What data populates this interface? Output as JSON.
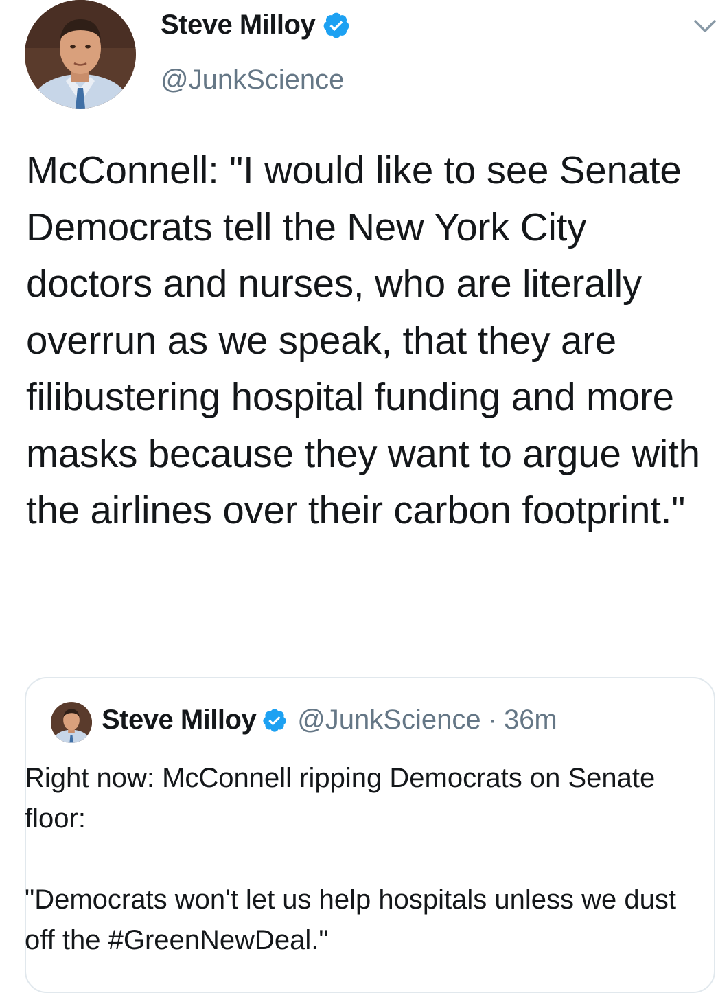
{
  "author": {
    "name": "Steve Milloy",
    "handle": "@JunkScience",
    "verified": true,
    "avatar_icon": "profile-photo"
  },
  "tweet": {
    "text": "McConnell: \"I would like to see Senate Democrats tell the New York City doctors and nurses, who are literally overrun as we speak, that they are filibustering hospital funding and more masks because they want to argue with the airlines over their carbon footprint.\""
  },
  "menu": {
    "icon": "chevron-down-icon"
  },
  "quoted_tweet": {
    "name": "Steve Milloy",
    "handle": "@JunkScience",
    "separator": "·",
    "time": "36m",
    "text": "Right now: McConnell ripping Democrats on Senate floor:\n\n\"Democrats won't let us help hospitals unless we dust off the #GreenNewDeal.\""
  },
  "colors": {
    "text": "#14171a",
    "secondary": "#657786",
    "verified_blue": "#1da1f2",
    "border": "#e1e8ed"
  }
}
